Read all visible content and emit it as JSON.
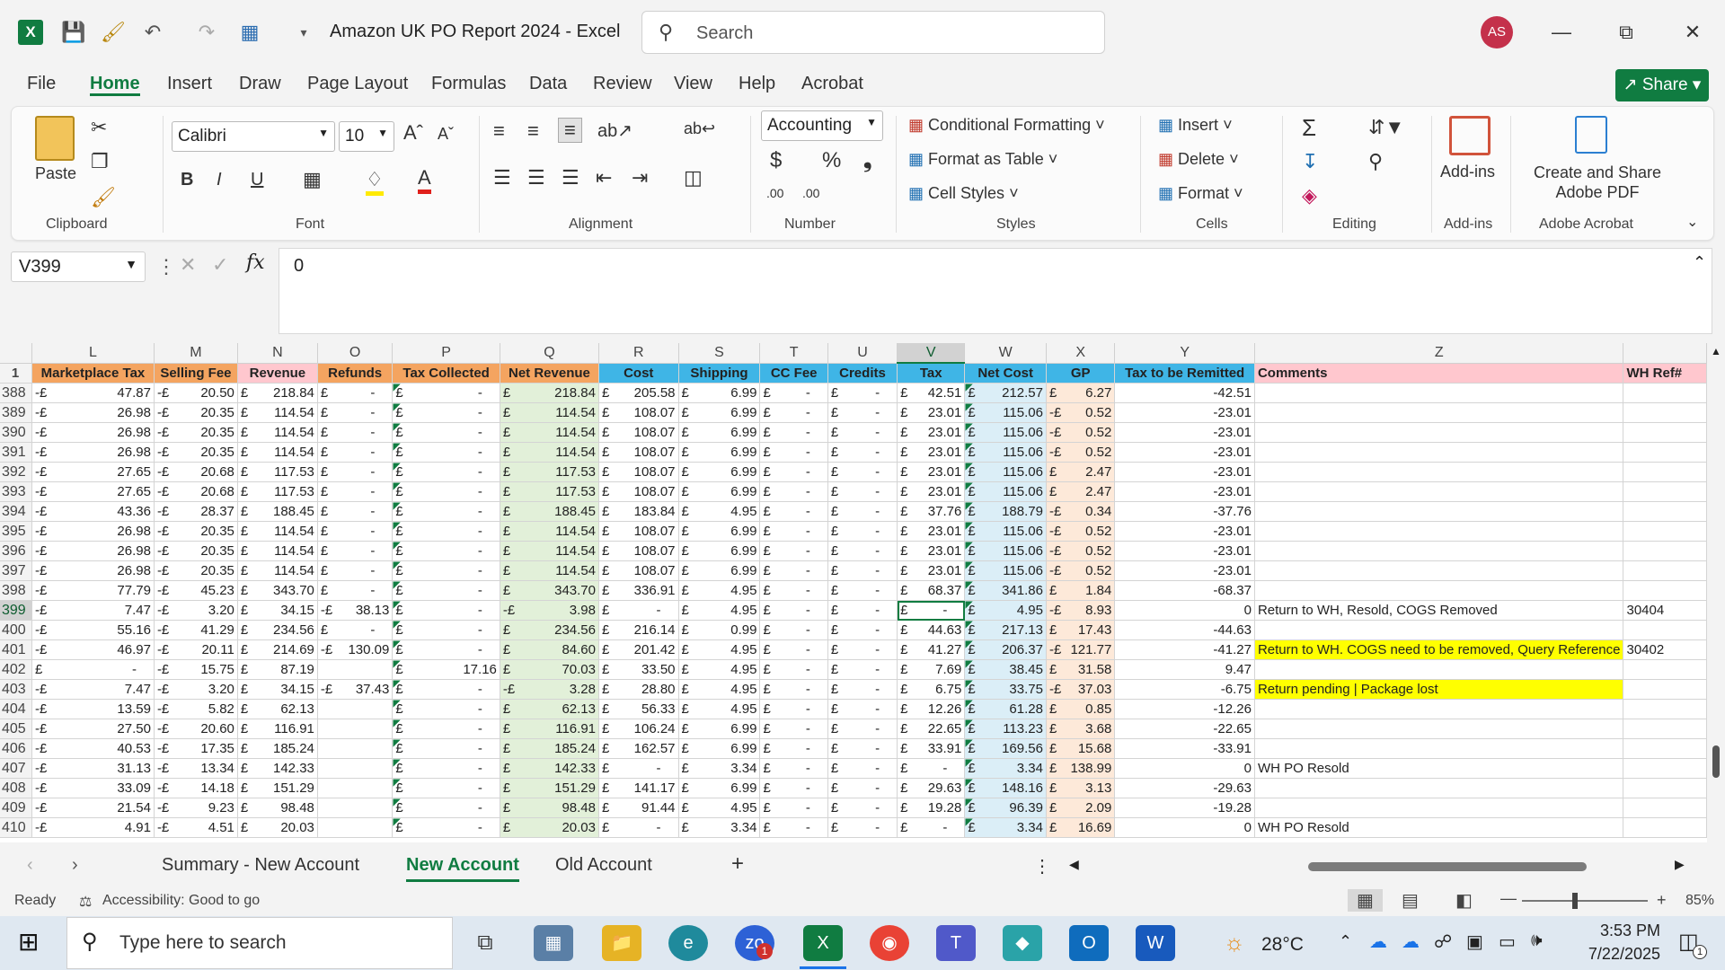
{
  "window": {
    "title": "Amazon UK PO Report 2024  -  Excel",
    "search_placeholder": "Search",
    "user_initials": "AS"
  },
  "menu": {
    "tabs": [
      "File",
      "Home",
      "Insert",
      "Draw",
      "Page Layout",
      "Formulas",
      "Data",
      "Review",
      "View",
      "Help",
      "Acrobat"
    ],
    "share_label": "Share"
  },
  "ribbon": {
    "clipboard": {
      "paste_label": "Paste",
      "group_label": "Clipboard"
    },
    "font": {
      "name": "Calibri",
      "size": "10",
      "group_label": "Font"
    },
    "alignment": {
      "group_label": "Alignment"
    },
    "number": {
      "format": "Accounting",
      "currency_symbol": "$",
      "percent_symbol": "%",
      "comma_symbol": "❟",
      "inc_decimal": ".00",
      "dec_decimal": ".00",
      "group_label": "Number"
    },
    "styles": {
      "conditional": "Conditional Formatting",
      "format_table": "Format as Table",
      "cell_styles": "Cell Styles",
      "group_label": "Styles"
    },
    "cells": {
      "insert": "Insert",
      "delete": "Delete",
      "format": "Format",
      "group_label": "Cells"
    },
    "editing": {
      "group_label": "Editing"
    },
    "addins": {
      "label": "Add-ins",
      "group_label": "Add-ins"
    },
    "acrobat": {
      "label": "Create and Share Adobe PDF",
      "group_label": "Adobe Acrobat"
    }
  },
  "formula_bar": {
    "name_box": "V399",
    "formula": "0"
  },
  "columns": [
    {
      "letter": "L",
      "header": "Marketplace Tax",
      "bg": "#f4a460"
    },
    {
      "letter": "M",
      "header": "Selling Fee",
      "bg": "#f4a460"
    },
    {
      "letter": "N",
      "header": "Revenue",
      "bg": "#ffc7ce"
    },
    {
      "letter": "O",
      "header": "Refunds",
      "bg": "#f4a460"
    },
    {
      "letter": "P",
      "header": "Tax Collected",
      "bg": "#f4a460"
    },
    {
      "letter": "Q",
      "header": "Net Revenue",
      "bg": "#f4a460"
    },
    {
      "letter": "R",
      "header": "Cost",
      "bg": "#3fb5e6"
    },
    {
      "letter": "S",
      "header": "Shipping",
      "bg": "#3fb5e6"
    },
    {
      "letter": "T",
      "header": "CC Fee",
      "bg": "#3fb5e6"
    },
    {
      "letter": "U",
      "header": "Credits",
      "bg": "#3fb5e6"
    },
    {
      "letter": "V",
      "header": "Tax",
      "bg": "#3fb5e6"
    },
    {
      "letter": "W",
      "header": "Net Cost",
      "bg": "#3fb5e6"
    },
    {
      "letter": "X",
      "header": "GP",
      "bg": "#3fb5e6"
    },
    {
      "letter": "Y",
      "header": "Tax to be Remitted",
      "bg": "#3fb5e6"
    },
    {
      "letter": "Z",
      "header": "Comments",
      "bg": "#ffc7ce"
    },
    {
      "letter": "",
      "header": "WH Ref#",
      "bg": "#ffc7ce"
    }
  ],
  "rows": [
    {
      "n": "388",
      "c": [
        "-£",
        "47.87",
        "-£",
        "20.50",
        "£",
        "218.84",
        "£",
        "-",
        "£",
        "-",
        "£",
        "218.84",
        "£",
        "205.58",
        "£",
        "6.99",
        "£",
        "-",
        "£",
        "-",
        "£",
        "42.51",
        "£",
        "212.57",
        "£",
        "6.27",
        "-42.51",
        "",
        ""
      ]
    },
    {
      "n": "389",
      "c": [
        "-£",
        "26.98",
        "-£",
        "20.35",
        "£",
        "114.54",
        "£",
        "-",
        "£",
        "-",
        "£",
        "114.54",
        "£",
        "108.07",
        "£",
        "6.99",
        "£",
        "-",
        "£",
        "-",
        "£",
        "23.01",
        "£",
        "115.06",
        "-£",
        "0.52",
        "-23.01",
        "",
        ""
      ]
    },
    {
      "n": "390",
      "c": [
        "-£",
        "26.98",
        "-£",
        "20.35",
        "£",
        "114.54",
        "£",
        "-",
        "£",
        "-",
        "£",
        "114.54",
        "£",
        "108.07",
        "£",
        "6.99",
        "£",
        "-",
        "£",
        "-",
        "£",
        "23.01",
        "£",
        "115.06",
        "-£",
        "0.52",
        "-23.01",
        "",
        ""
      ]
    },
    {
      "n": "391",
      "c": [
        "-£",
        "26.98",
        "-£",
        "20.35",
        "£",
        "114.54",
        "£",
        "-",
        "£",
        "-",
        "£",
        "114.54",
        "£",
        "108.07",
        "£",
        "6.99",
        "£",
        "-",
        "£",
        "-",
        "£",
        "23.01",
        "£",
        "115.06",
        "-£",
        "0.52",
        "-23.01",
        "",
        ""
      ]
    },
    {
      "n": "392",
      "c": [
        "-£",
        "27.65",
        "-£",
        "20.68",
        "£",
        "117.53",
        "£",
        "-",
        "£",
        "-",
        "£",
        "117.53",
        "£",
        "108.07",
        "£",
        "6.99",
        "£",
        "-",
        "£",
        "-",
        "£",
        "23.01",
        "£",
        "115.06",
        "£",
        "2.47",
        "-23.01",
        "",
        ""
      ]
    },
    {
      "n": "393",
      "c": [
        "-£",
        "27.65",
        "-£",
        "20.68",
        "£",
        "117.53",
        "£",
        "-",
        "£",
        "-",
        "£",
        "117.53",
        "£",
        "108.07",
        "£",
        "6.99",
        "£",
        "-",
        "£",
        "-",
        "£",
        "23.01",
        "£",
        "115.06",
        "£",
        "2.47",
        "-23.01",
        "",
        ""
      ]
    },
    {
      "n": "394",
      "c": [
        "-£",
        "43.36",
        "-£",
        "28.37",
        "£",
        "188.45",
        "£",
        "-",
        "£",
        "-",
        "£",
        "188.45",
        "£",
        "183.84",
        "£",
        "4.95",
        "£",
        "-",
        "£",
        "-",
        "£",
        "37.76",
        "£",
        "188.79",
        "-£",
        "0.34",
        "-37.76",
        "",
        ""
      ]
    },
    {
      "n": "395",
      "c": [
        "-£",
        "26.98",
        "-£",
        "20.35",
        "£",
        "114.54",
        "£",
        "-",
        "£",
        "-",
        "£",
        "114.54",
        "£",
        "108.07",
        "£",
        "6.99",
        "£",
        "-",
        "£",
        "-",
        "£",
        "23.01",
        "£",
        "115.06",
        "-£",
        "0.52",
        "-23.01",
        "",
        ""
      ]
    },
    {
      "n": "396",
      "c": [
        "-£",
        "26.98",
        "-£",
        "20.35",
        "£",
        "114.54",
        "£",
        "-",
        "£",
        "-",
        "£",
        "114.54",
        "£",
        "108.07",
        "£",
        "6.99",
        "£",
        "-",
        "£",
        "-",
        "£",
        "23.01",
        "£",
        "115.06",
        "-£",
        "0.52",
        "-23.01",
        "",
        ""
      ]
    },
    {
      "n": "397",
      "c": [
        "-£",
        "26.98",
        "-£",
        "20.35",
        "£",
        "114.54",
        "£",
        "-",
        "£",
        "-",
        "£",
        "114.54",
        "£",
        "108.07",
        "£",
        "6.99",
        "£",
        "-",
        "£",
        "-",
        "£",
        "23.01",
        "£",
        "115.06",
        "-£",
        "0.52",
        "-23.01",
        "",
        ""
      ]
    },
    {
      "n": "398",
      "c": [
        "-£",
        "77.79",
        "-£",
        "45.23",
        "£",
        "343.70",
        "£",
        "-",
        "£",
        "-",
        "£",
        "343.70",
        "£",
        "336.91",
        "£",
        "4.95",
        "£",
        "-",
        "£",
        "-",
        "£",
        "68.37",
        "£",
        "341.86",
        "£",
        "1.84",
        "-68.37",
        "",
        ""
      ]
    },
    {
      "n": "399",
      "c": [
        "-£",
        "7.47",
        "-£",
        "3.20",
        "£",
        "34.15",
        "-£",
        "38.13",
        "£",
        "-",
        "-£",
        "3.98",
        "£",
        "-",
        "£",
        "4.95",
        "£",
        "-",
        "£",
        "-",
        "£",
        "-",
        "£",
        "4.95",
        "-£",
        "8.93",
        "0",
        "Return to WH, Resold, COGS Removed",
        "30404"
      ]
    },
    {
      "n": "400",
      "c": [
        "-£",
        "55.16",
        "-£",
        "41.29",
        "£",
        "234.56",
        "£",
        "-",
        "£",
        "-",
        "£",
        "234.56",
        "£",
        "216.14",
        "£",
        "0.99",
        "£",
        "-",
        "£",
        "-",
        "£",
        "44.63",
        "£",
        "217.13",
        "£",
        "17.43",
        "-44.63",
        "",
        ""
      ]
    },
    {
      "n": "401",
      "c": [
        "-£",
        "46.97",
        "-£",
        "20.11",
        "£",
        "214.69",
        "-£",
        "130.09",
        "£",
        "-",
        "£",
        "84.60",
        "£",
        "201.42",
        "£",
        "4.95",
        "£",
        "-",
        "£",
        "-",
        "£",
        "41.27",
        "£",
        "206.37",
        "-£",
        "121.77",
        "-41.27",
        "Return to WH. COGS need to be removed, Query Reference",
        "30402"
      ]
    },
    {
      "n": "402",
      "c": [
        "£",
        "-",
        "-£",
        "15.75",
        "£",
        "87.19",
        "",
        "",
        "£",
        "17.16",
        "£",
        "70.03",
        "£",
        "33.50",
        "£",
        "4.95",
        "£",
        "-",
        "£",
        "-",
        "£",
        "7.69",
        "£",
        "38.45",
        "£",
        "31.58",
        "9.47",
        "",
        ""
      ]
    },
    {
      "n": "403",
      "c": [
        "-£",
        "7.47",
        "-£",
        "3.20",
        "£",
        "34.15",
        "-£",
        "37.43",
        "£",
        "-",
        "-£",
        "3.28",
        "£",
        "28.80",
        "£",
        "4.95",
        "£",
        "-",
        "£",
        "-",
        "£",
        "6.75",
        "£",
        "33.75",
        "-£",
        "37.03",
        "-6.75",
        "Return pending | Package lost",
        ""
      ]
    },
    {
      "n": "404",
      "c": [
        "-£",
        "13.59",
        "-£",
        "5.82",
        "£",
        "62.13",
        "",
        "",
        "£",
        "-",
        "£",
        "62.13",
        "£",
        "56.33",
        "£",
        "4.95",
        "£",
        "-",
        "£",
        "-",
        "£",
        "12.26",
        "£",
        "61.28",
        "£",
        "0.85",
        "-12.26",
        "",
        ""
      ]
    },
    {
      "n": "405",
      "c": [
        "-£",
        "27.50",
        "-£",
        "20.60",
        "£",
        "116.91",
        "",
        "",
        "£",
        "-",
        "£",
        "116.91",
        "£",
        "106.24",
        "£",
        "6.99",
        "£",
        "-",
        "£",
        "-",
        "£",
        "22.65",
        "£",
        "113.23",
        "£",
        "3.68",
        "-22.65",
        "",
        ""
      ]
    },
    {
      "n": "406",
      "c": [
        "-£",
        "40.53",
        "-£",
        "17.35",
        "£",
        "185.24",
        "",
        "",
        "£",
        "-",
        "£",
        "185.24",
        "£",
        "162.57",
        "£",
        "6.99",
        "£",
        "-",
        "£",
        "-",
        "£",
        "33.91",
        "£",
        "169.56",
        "£",
        "15.68",
        "-33.91",
        "",
        ""
      ]
    },
    {
      "n": "407",
      "c": [
        "-£",
        "31.13",
        "-£",
        "13.34",
        "£",
        "142.33",
        "",
        "",
        "£",
        "-",
        "£",
        "142.33",
        "£",
        "-",
        "£",
        "3.34",
        "£",
        "-",
        "£",
        "-",
        "£",
        "-",
        "£",
        "3.34",
        "£",
        "138.99",
        "0",
        "WH PO Resold",
        ""
      ]
    },
    {
      "n": "408",
      "c": [
        "-£",
        "33.09",
        "-£",
        "14.18",
        "£",
        "151.29",
        "",
        "",
        "£",
        "-",
        "£",
        "151.29",
        "£",
        "141.17",
        "£",
        "6.99",
        "£",
        "-",
        "£",
        "-",
        "£",
        "29.63",
        "£",
        "148.16",
        "£",
        "3.13",
        "-29.63",
        "",
        ""
      ]
    },
    {
      "n": "409",
      "c": [
        "-£",
        "21.54",
        "-£",
        "9.23",
        "£",
        "98.48",
        "",
        "",
        "£",
        "-",
        "£",
        "98.48",
        "£",
        "91.44",
        "£",
        "4.95",
        "£",
        "-",
        "£",
        "-",
        "£",
        "19.28",
        "£",
        "96.39",
        "£",
        "2.09",
        "-19.28",
        "",
        ""
      ]
    },
    {
      "n": "410",
      "c": [
        "-£",
        "4.91",
        "-£",
        "4.51",
        "£",
        "20.03",
        "",
        "",
        "£",
        "-",
        "£",
        "20.03",
        "£",
        "-",
        "£",
        "3.34",
        "£",
        "-",
        "£",
        "-",
        "£",
        "-",
        "£",
        "3.34",
        "£",
        "16.69",
        "0",
        "WH PO Resold",
        ""
      ]
    }
  ],
  "highlight_rows": [
    "401",
    "403"
  ],
  "sheets": {
    "tabs": [
      "Summary - New Account",
      "New Account",
      "Old Account"
    ],
    "active": "New Account",
    "add": "+"
  },
  "status": {
    "ready": "Ready",
    "accessibility": "Accessibility: Good to go",
    "zoom": "85%"
  },
  "taskbar": {
    "search_placeholder": "Type here to search",
    "weather": "28°C",
    "time": "3:53 PM",
    "date": "7/22/2025",
    "teams_badge": "1",
    "notif_badge": "1"
  }
}
